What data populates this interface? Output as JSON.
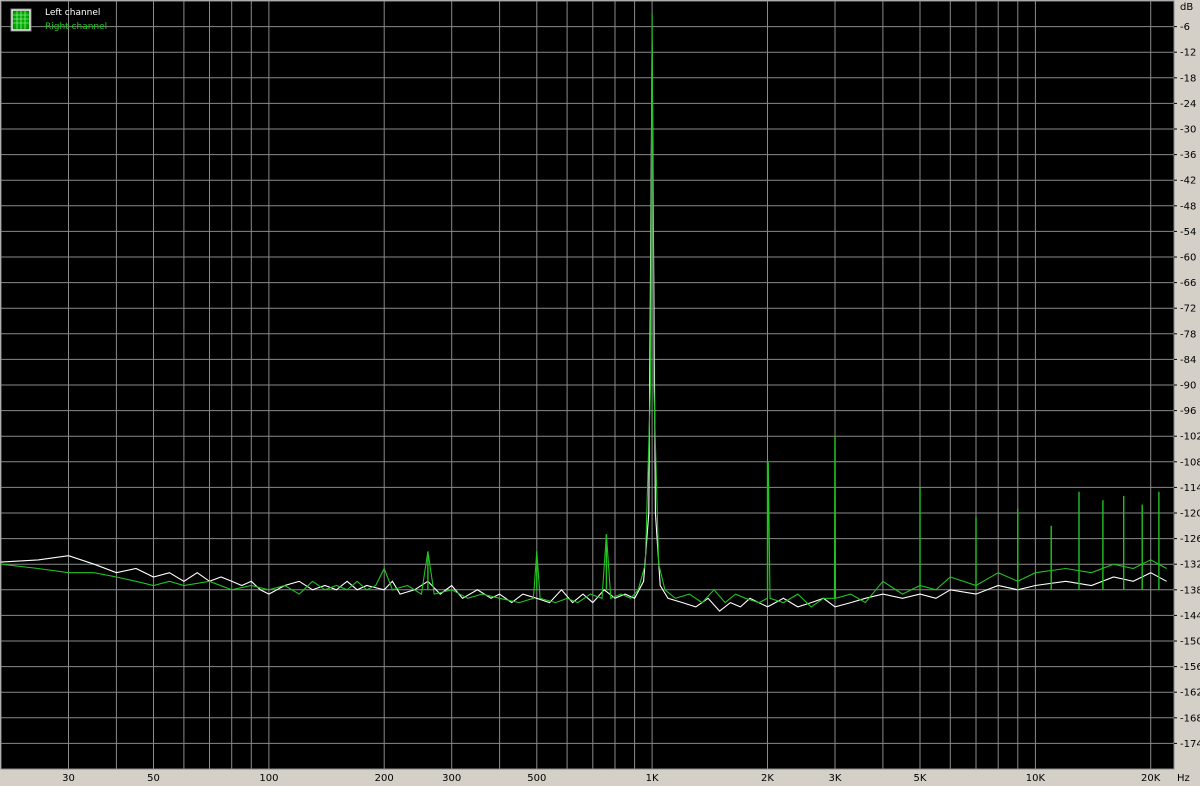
{
  "chart_data": {
    "type": "line",
    "title": "",
    "x_scale": "log",
    "xlim": [
      20,
      23000
    ],
    "ylim": [
      -180,
      0
    ],
    "x_unit": "Hz",
    "y_unit": "dB",
    "x_ticks": [
      {
        "value": 30,
        "label": "30"
      },
      {
        "value": 50,
        "label": "50"
      },
      {
        "value": 100,
        "label": "100"
      },
      {
        "value": 200,
        "label": "200"
      },
      {
        "value": 300,
        "label": "300"
      },
      {
        "value": 500,
        "label": "500"
      },
      {
        "value": 1000,
        "label": "1K"
      },
      {
        "value": 2000,
        "label": "2K"
      },
      {
        "value": 3000,
        "label": "3K"
      },
      {
        "value": 5000,
        "label": "5K"
      },
      {
        "value": 10000,
        "label": "10K"
      },
      {
        "value": 20000,
        "label": "20K"
      }
    ],
    "x_grid": [
      20,
      30,
      40,
      50,
      60,
      70,
      80,
      90,
      100,
      200,
      300,
      400,
      500,
      600,
      700,
      800,
      900,
      1000,
      2000,
      3000,
      4000,
      5000,
      6000,
      7000,
      8000,
      9000,
      10000,
      20000
    ],
    "y_ticks": [
      -6,
      -12,
      -18,
      -24,
      -30,
      -36,
      -42,
      -48,
      -54,
      -60,
      -66,
      -72,
      -78,
      -84,
      -90,
      -96,
      -102,
      -108,
      -114,
      -120,
      -126,
      -132,
      -138,
      -144,
      -150,
      -156,
      -162,
      -168,
      -174
    ],
    "grid": true,
    "legend_position": "top-left",
    "series": [
      {
        "name": "Left channel",
        "color": "#ffffff",
        "points": [
          [
            20,
            -131.5
          ],
          [
            25,
            -131
          ],
          [
            30,
            -130
          ],
          [
            35,
            -132
          ],
          [
            40,
            -134
          ],
          [
            45,
            -133
          ],
          [
            50,
            -135
          ],
          [
            55,
            -134
          ],
          [
            60,
            -136
          ],
          [
            65,
            -134
          ],
          [
            70,
            -136
          ],
          [
            75,
            -135
          ],
          [
            80,
            -136
          ],
          [
            85,
            -137
          ],
          [
            90,
            -136
          ],
          [
            95,
            -138
          ],
          [
            100,
            -139
          ],
          [
            110,
            -137
          ],
          [
            120,
            -136
          ],
          [
            130,
            -138
          ],
          [
            140,
            -137
          ],
          [
            150,
            -138
          ],
          [
            160,
            -136
          ],
          [
            170,
            -138
          ],
          [
            180,
            -137
          ],
          [
            200,
            -138
          ],
          [
            210,
            -136
          ],
          [
            220,
            -139
          ],
          [
            240,
            -138
          ],
          [
            260,
            -136
          ],
          [
            280,
            -139
          ],
          [
            300,
            -137
          ],
          [
            320,
            -140
          ],
          [
            350,
            -138
          ],
          [
            380,
            -140
          ],
          [
            400,
            -139
          ],
          [
            430,
            -141
          ],
          [
            460,
            -139
          ],
          [
            500,
            -140
          ],
          [
            540,
            -141
          ],
          [
            580,
            -138
          ],
          [
            620,
            -141
          ],
          [
            660,
            -139
          ],
          [
            700,
            -141
          ],
          [
            750,
            -138
          ],
          [
            800,
            -140
          ],
          [
            850,
            -139
          ],
          [
            900,
            -140
          ],
          [
            950,
            -136
          ],
          [
            980,
            -120
          ],
          [
            1000,
            -10
          ],
          [
            1020,
            -120
          ],
          [
            1050,
            -137
          ],
          [
            1100,
            -140
          ],
          [
            1200,
            -141
          ],
          [
            1300,
            -142
          ],
          [
            1400,
            -140
          ],
          [
            1500,
            -143
          ],
          [
            1600,
            -141
          ],
          [
            1700,
            -142
          ],
          [
            1800,
            -140
          ],
          [
            2000,
            -142
          ],
          [
            2200,
            -140
          ],
          [
            2400,
            -142
          ],
          [
            2600,
            -141
          ],
          [
            2800,
            -140
          ],
          [
            3000,
            -142
          ],
          [
            3300,
            -141
          ],
          [
            3600,
            -140
          ],
          [
            4000,
            -139
          ],
          [
            4500,
            -140
          ],
          [
            5000,
            -139
          ],
          [
            5500,
            -140
          ],
          [
            6000,
            -138
          ],
          [
            7000,
            -139
          ],
          [
            8000,
            -137
          ],
          [
            9000,
            -138
          ],
          [
            10000,
            -137
          ],
          [
            12000,
            -136
          ],
          [
            14000,
            -137
          ],
          [
            16000,
            -135
          ],
          [
            18000,
            -136
          ],
          [
            20000,
            -134
          ],
          [
            22000,
            -136
          ]
        ]
      },
      {
        "name": "Right channel",
        "color": "#22c222",
        "points": [
          [
            20,
            -132
          ],
          [
            25,
            -133
          ],
          [
            30,
            -134
          ],
          [
            35,
            -134
          ],
          [
            40,
            -135
          ],
          [
            45,
            -136
          ],
          [
            50,
            -137
          ],
          [
            55,
            -136
          ],
          [
            60,
            -137
          ],
          [
            70,
            -136
          ],
          [
            80,
            -138
          ],
          [
            90,
            -137
          ],
          [
            100,
            -138
          ],
          [
            110,
            -137
          ],
          [
            120,
            -139
          ],
          [
            130,
            -136
          ],
          [
            140,
            -138
          ],
          [
            150,
            -137
          ],
          [
            160,
            -138
          ],
          [
            170,
            -136
          ],
          [
            180,
            -138
          ],
          [
            190,
            -137
          ],
          [
            200,
            -133
          ],
          [
            210,
            -138
          ],
          [
            230,
            -137
          ],
          [
            250,
            -139
          ],
          [
            260,
            -129
          ],
          [
            270,
            -139
          ],
          [
            300,
            -138
          ],
          [
            330,
            -140
          ],
          [
            360,
            -139
          ],
          [
            400,
            -140
          ],
          [
            450,
            -141
          ],
          [
            490,
            -140
          ],
          [
            500,
            -129
          ],
          [
            510,
            -140
          ],
          [
            560,
            -141
          ],
          [
            600,
            -140
          ],
          [
            640,
            -141
          ],
          [
            690,
            -139
          ],
          [
            740,
            -140
          ],
          [
            760,
            -125
          ],
          [
            780,
            -140
          ],
          [
            830,
            -139
          ],
          [
            880,
            -140
          ],
          [
            920,
            -138
          ],
          [
            960,
            -132
          ],
          [
            990,
            -90
          ],
          [
            1000,
            -3
          ],
          [
            1010,
            -90
          ],
          [
            1040,
            -132
          ],
          [
            1080,
            -138
          ],
          [
            1150,
            -140
          ],
          [
            1250,
            -139
          ],
          [
            1350,
            -141
          ],
          [
            1450,
            -138
          ],
          [
            1550,
            -141
          ],
          [
            1650,
            -139
          ],
          [
            1750,
            -140
          ],
          [
            1900,
            -141
          ],
          [
            2000,
            -140
          ],
          [
            2010,
            -108
          ],
          [
            2030,
            -140
          ],
          [
            2200,
            -141
          ],
          [
            2400,
            -139
          ],
          [
            2600,
            -142
          ],
          [
            2800,
            -140
          ],
          [
            2990,
            -140
          ],
          [
            3000,
            -102
          ],
          [
            3010,
            -140
          ],
          [
            3300,
            -139
          ],
          [
            3600,
            -141
          ],
          [
            4000,
            -136
          ],
          [
            4500,
            -139
          ],
          [
            5000,
            -137
          ],
          [
            5500,
            -138
          ],
          [
            6000,
            -135
          ],
          [
            7000,
            -137
          ],
          [
            8000,
            -134
          ],
          [
            9000,
            -136
          ],
          [
            10000,
            -134
          ],
          [
            12000,
            -133
          ],
          [
            14000,
            -134
          ],
          [
            16000,
            -132
          ],
          [
            18000,
            -133
          ],
          [
            20000,
            -131
          ],
          [
            22000,
            -133
          ]
        ]
      }
    ],
    "spikes": [
      {
        "series": "Right channel",
        "x": 260,
        "y": -129
      },
      {
        "series": "Right channel",
        "x": 500,
        "y": -129
      },
      {
        "series": "Right channel",
        "x": 760,
        "y": -125
      },
      {
        "series": "Right channel",
        "x": 2000,
        "y": -108
      },
      {
        "series": "Right channel",
        "x": 3000,
        "y": -102
      },
      {
        "series": "Right channel",
        "x": 5000,
        "y": -114
      },
      {
        "series": "Right channel",
        "x": 7000,
        "y": -121
      },
      {
        "series": "Right channel",
        "x": 9000,
        "y": -119
      },
      {
        "series": "Right channel",
        "x": 11000,
        "y": -123
      },
      {
        "series": "Right channel",
        "x": 13000,
        "y": -115
      },
      {
        "series": "Right channel",
        "x": 15000,
        "y": -117
      },
      {
        "series": "Right channel",
        "x": 17000,
        "y": -116
      },
      {
        "series": "Right channel",
        "x": 19000,
        "y": -118
      },
      {
        "series": "Right channel",
        "x": 21000,
        "y": -115
      }
    ]
  }
}
